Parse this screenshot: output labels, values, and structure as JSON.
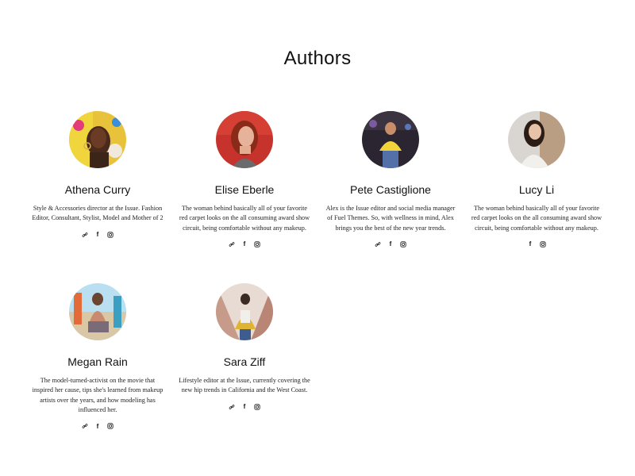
{
  "page": {
    "title": "Authors"
  },
  "authors": [
    {
      "name": "Athena Curry",
      "bio": "Style & Accessories director at the Issue. Fashion Editor, Consultant, Stylist, Model and Mother of 2",
      "social": [
        "link-icon",
        "facebook-icon",
        "instagram-icon"
      ]
    },
    {
      "name": "Elise Eberle",
      "bio": "The woman behind basically all of your favorite red carpet looks on the all consuming award show circuit, being comfortable without any makeup.",
      "social": [
        "link-icon",
        "facebook-icon",
        "instagram-icon"
      ]
    },
    {
      "name": "Pete Castiglione",
      "bio": "Alex is the Issue editor and social media manager of Fuel Themes. So, with wellness in mind, Alex brings you the best of the new year trends.",
      "social": [
        "link-icon",
        "facebook-icon",
        "instagram-icon"
      ]
    },
    {
      "name": "Lucy Li",
      "bio": "The woman behind basically all of your favorite red carpet looks on the all consuming award show circuit, being comfortable without any makeup.",
      "social": [
        "facebook-icon",
        "instagram-icon"
      ]
    },
    {
      "name": "Megan Rain",
      "bio": "The model-turned-activist on the movie that inspired her cause, tips she's learned from makeup artists over the years, and how modeling has influenced her.",
      "social": [
        "link-icon",
        "facebook-icon",
        "instagram-icon"
      ]
    },
    {
      "name": "Sara Ziff",
      "bio": "Lifestyle editor at the Issue, currently covering the new hip trends in California and the West Coast.",
      "social": [
        "link-icon",
        "facebook-icon",
        "instagram-icon"
      ]
    }
  ],
  "colors": {
    "text": "#111111",
    "background": "#ffffff"
  }
}
